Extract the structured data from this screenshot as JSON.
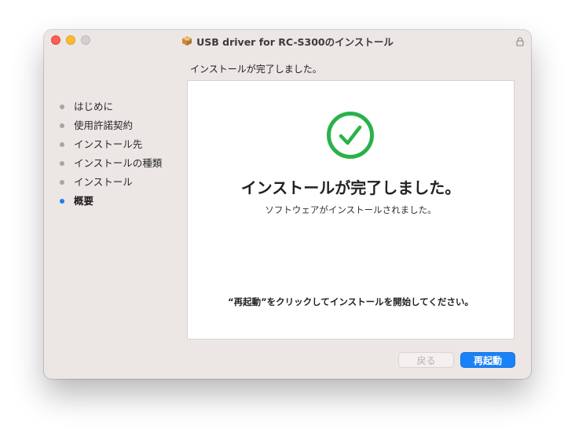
{
  "window": {
    "title": "USB driver for RC-S300のインストール",
    "icons": {
      "package": "package-icon",
      "lock": "lock-icon"
    }
  },
  "header": {
    "status_text": "インストールが完了しました。"
  },
  "sidebar": {
    "steps": [
      {
        "label": "はじめに",
        "active": false
      },
      {
        "label": "使用許諾契約",
        "active": false
      },
      {
        "label": "インストール先",
        "active": false
      },
      {
        "label": "インストールの種類",
        "active": false
      },
      {
        "label": "インストール",
        "active": false
      },
      {
        "label": "概要",
        "active": true
      }
    ]
  },
  "main": {
    "icon": "checkmark-circle-icon",
    "title": "インストールが完了しました。",
    "subtitle": "ソフトウェアがインストールされました。",
    "instruction": "“再起動”をクリックしてインストールを開始してください。"
  },
  "buttons": {
    "back_label": "戻る",
    "restart_label": "再起動"
  },
  "colors": {
    "accent": "#1a82f7",
    "success": "#2ab24a",
    "active_dot": "#1e7cf2"
  }
}
